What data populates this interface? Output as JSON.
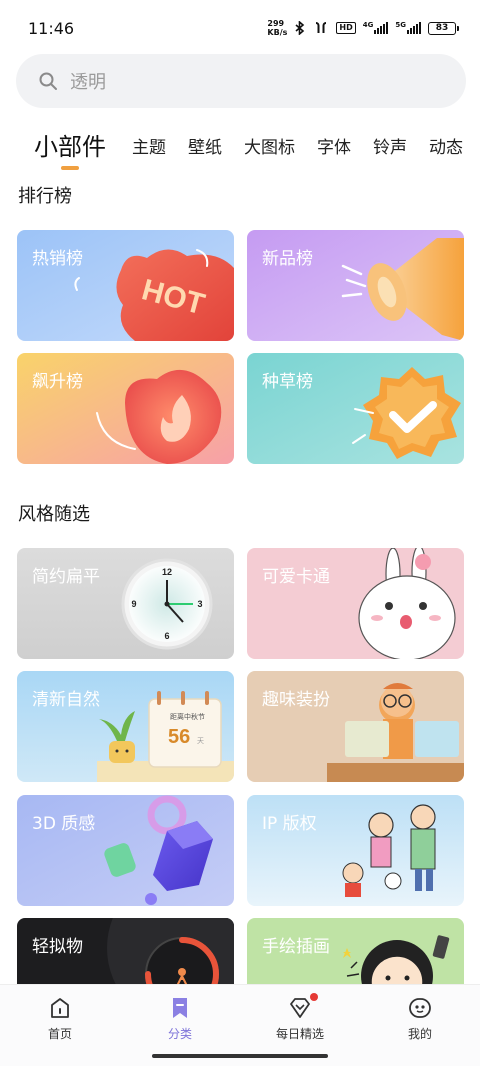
{
  "status_bar": {
    "time": "11:46",
    "net_speed_value": "299",
    "net_speed_unit": "KB/s",
    "hd_label": "HD",
    "sim1_label": "4G",
    "sim2_label": "5G",
    "battery": "83"
  },
  "search": {
    "placeholder": "透明"
  },
  "tabs": [
    {
      "label": "小部件",
      "active": true
    },
    {
      "label": "主题"
    },
    {
      "label": "壁纸"
    },
    {
      "label": "大图标"
    },
    {
      "label": "字体"
    },
    {
      "label": "铃声"
    },
    {
      "label": "动态"
    }
  ],
  "rankings": {
    "title": "排行榜",
    "cards": [
      {
        "label": "热销榜",
        "art_text": "HOT"
      },
      {
        "label": "新品榜"
      },
      {
        "label": "飙升榜"
      },
      {
        "label": "种草榜"
      }
    ]
  },
  "styles": {
    "title": "风格随选",
    "cards": [
      {
        "label": "简约扁平",
        "clock_numbers": [
          "12",
          "3",
          "6",
          "9"
        ]
      },
      {
        "label": "可爱卡通"
      },
      {
        "label": "清新自然",
        "calendar_text": "距离中秋节",
        "calendar_number": "56",
        "calendar_unit": "天"
      },
      {
        "label": "趣味装扮"
      },
      {
        "label": "3D 质感"
      },
      {
        "label": "IP 版权"
      },
      {
        "label": "轻拟物"
      },
      {
        "label": "手绘插画"
      }
    ]
  },
  "bottom_nav": [
    {
      "label": "首页",
      "icon": "home-icon"
    },
    {
      "label": "分类",
      "icon": "bookmark-icon",
      "active": true
    },
    {
      "label": "每日精选",
      "icon": "diamond-icon",
      "badge": true
    },
    {
      "label": "我的",
      "icon": "face-icon"
    }
  ],
  "colors": {
    "accent_underline": "#f0a040",
    "nav_active": "#7d73d9"
  }
}
